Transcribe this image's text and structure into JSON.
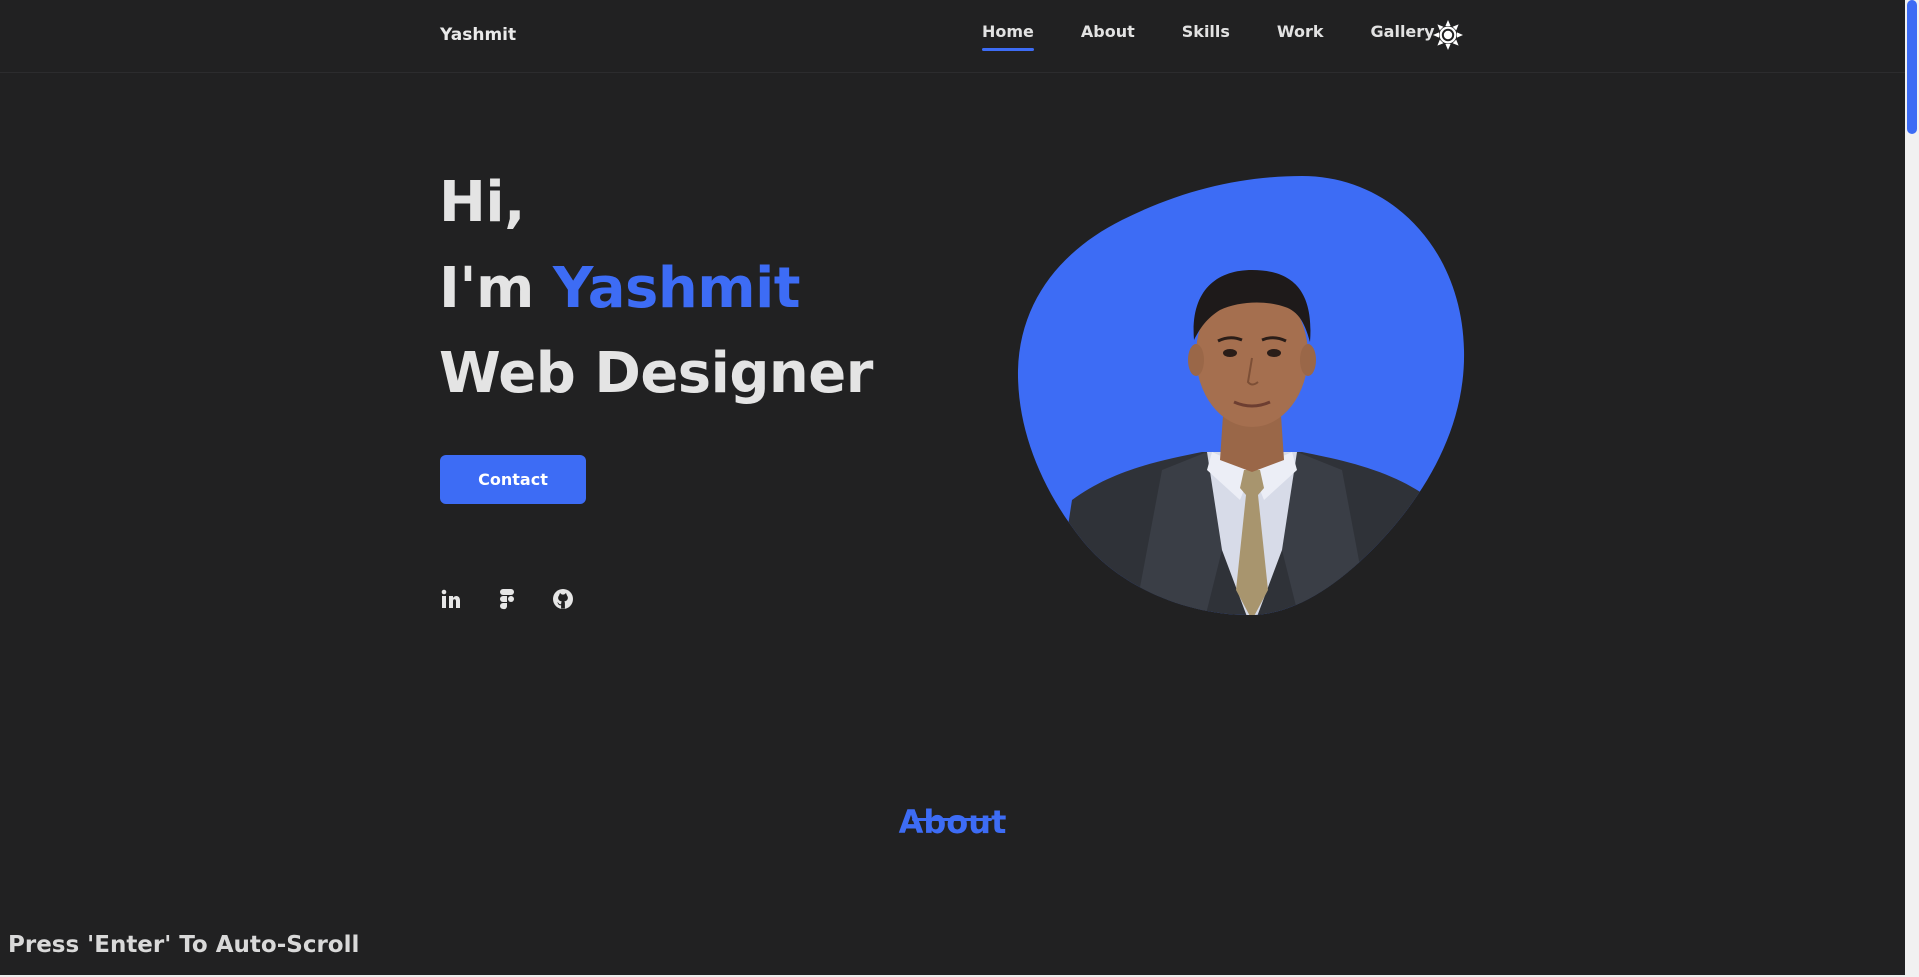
{
  "header": {
    "brand": "Yashmit",
    "nav": [
      {
        "label": "Home",
        "active": true
      },
      {
        "label": "About",
        "active": false
      },
      {
        "label": "Skills",
        "active": false
      },
      {
        "label": "Work",
        "active": false
      },
      {
        "label": "Gallery",
        "active": false
      }
    ],
    "theme_icon": "sun-icon"
  },
  "hero": {
    "greeting": "Hi,",
    "intro_prefix": "I'm ",
    "name": "Yashmit",
    "role": "Web Designer",
    "contact_label": "Contact",
    "socials": [
      {
        "icon": "linkedin-icon"
      },
      {
        "icon": "figma-icon"
      },
      {
        "icon": "github-icon"
      }
    ],
    "portrait_icon": "portrait-image"
  },
  "about": {
    "title": "About"
  },
  "hint": "Press 'Enter' To Auto-Scroll",
  "colors": {
    "background": "#212122",
    "accent": "#3d6cf5",
    "text": "#e4e4e4"
  }
}
